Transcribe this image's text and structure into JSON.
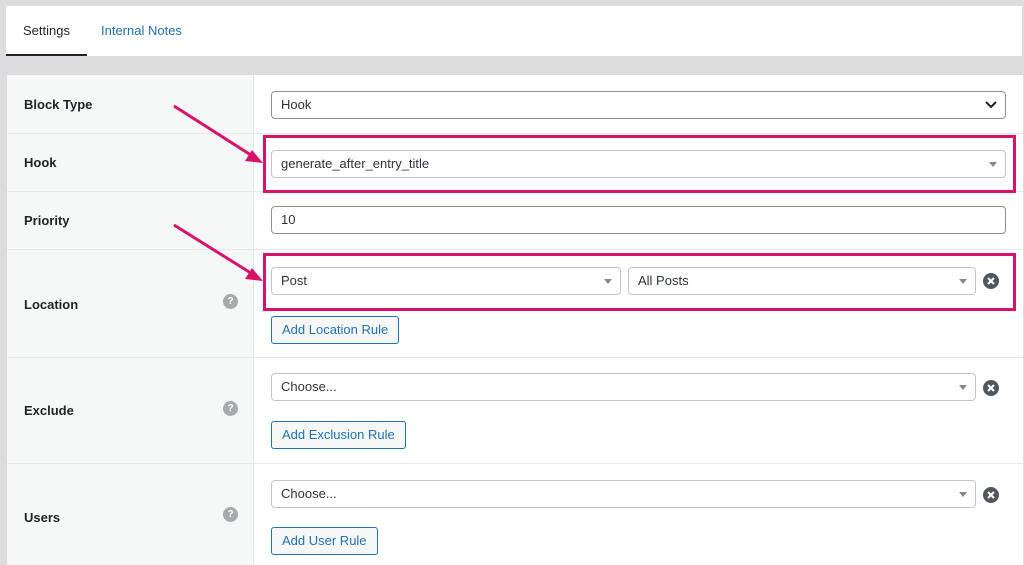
{
  "tabs": [
    {
      "label": "Settings",
      "active": true
    },
    {
      "label": "Internal Notes",
      "active": false
    }
  ],
  "rows": {
    "block_type": {
      "label": "Block Type",
      "value": "Hook"
    },
    "hook": {
      "label": "Hook",
      "value": "generate_after_entry_title"
    },
    "priority": {
      "label": "Priority",
      "value": "10"
    },
    "location": {
      "label": "Location",
      "help": "?",
      "rule_value": "Post",
      "object_value": "All Posts",
      "add_button": "Add Location Rule"
    },
    "exclude": {
      "label": "Exclude",
      "help": "?",
      "value": "Choose...",
      "add_button": "Add Exclusion Rule"
    },
    "users": {
      "label": "Users",
      "help": "?",
      "value": "Choose...",
      "add_button": "Add User Rule"
    }
  },
  "colors": {
    "highlight": "#d6126b",
    "link": "#2271b1",
    "label_bg": "#f6f7f7"
  }
}
